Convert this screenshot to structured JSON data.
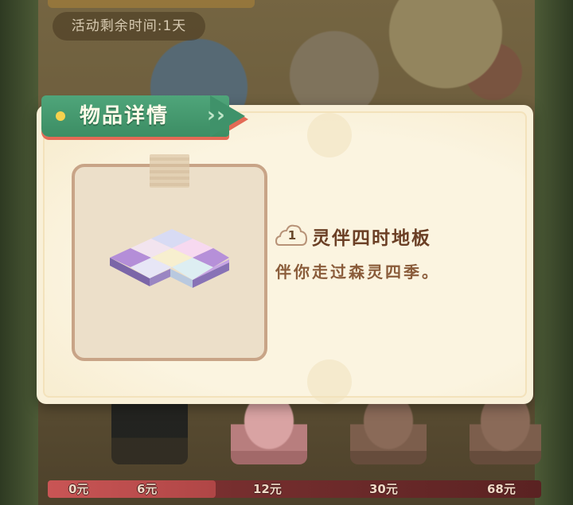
{
  "background": {
    "timer_text": "活动剩余时间:1天"
  },
  "rewards": {
    "prices": [
      "0元",
      "6元",
      "12元",
      "30元",
      "68元"
    ]
  },
  "modal": {
    "title": "物品详情",
    "item": {
      "quantity": "1",
      "name": "灵伴四时地板",
      "description": "伴你走过森灵四季。"
    }
  },
  "colors": {
    "ribbon_green": "#3f926a",
    "ribbon_red": "#e36a55",
    "panel_cream": "#f9f0d8",
    "item_name_brown": "#6b3f25",
    "item_desc_brown": "#8a5c3a"
  },
  "icons": {
    "item": "pastel-floor-tile-icon",
    "quantity": "cloud-badge-icon"
  }
}
